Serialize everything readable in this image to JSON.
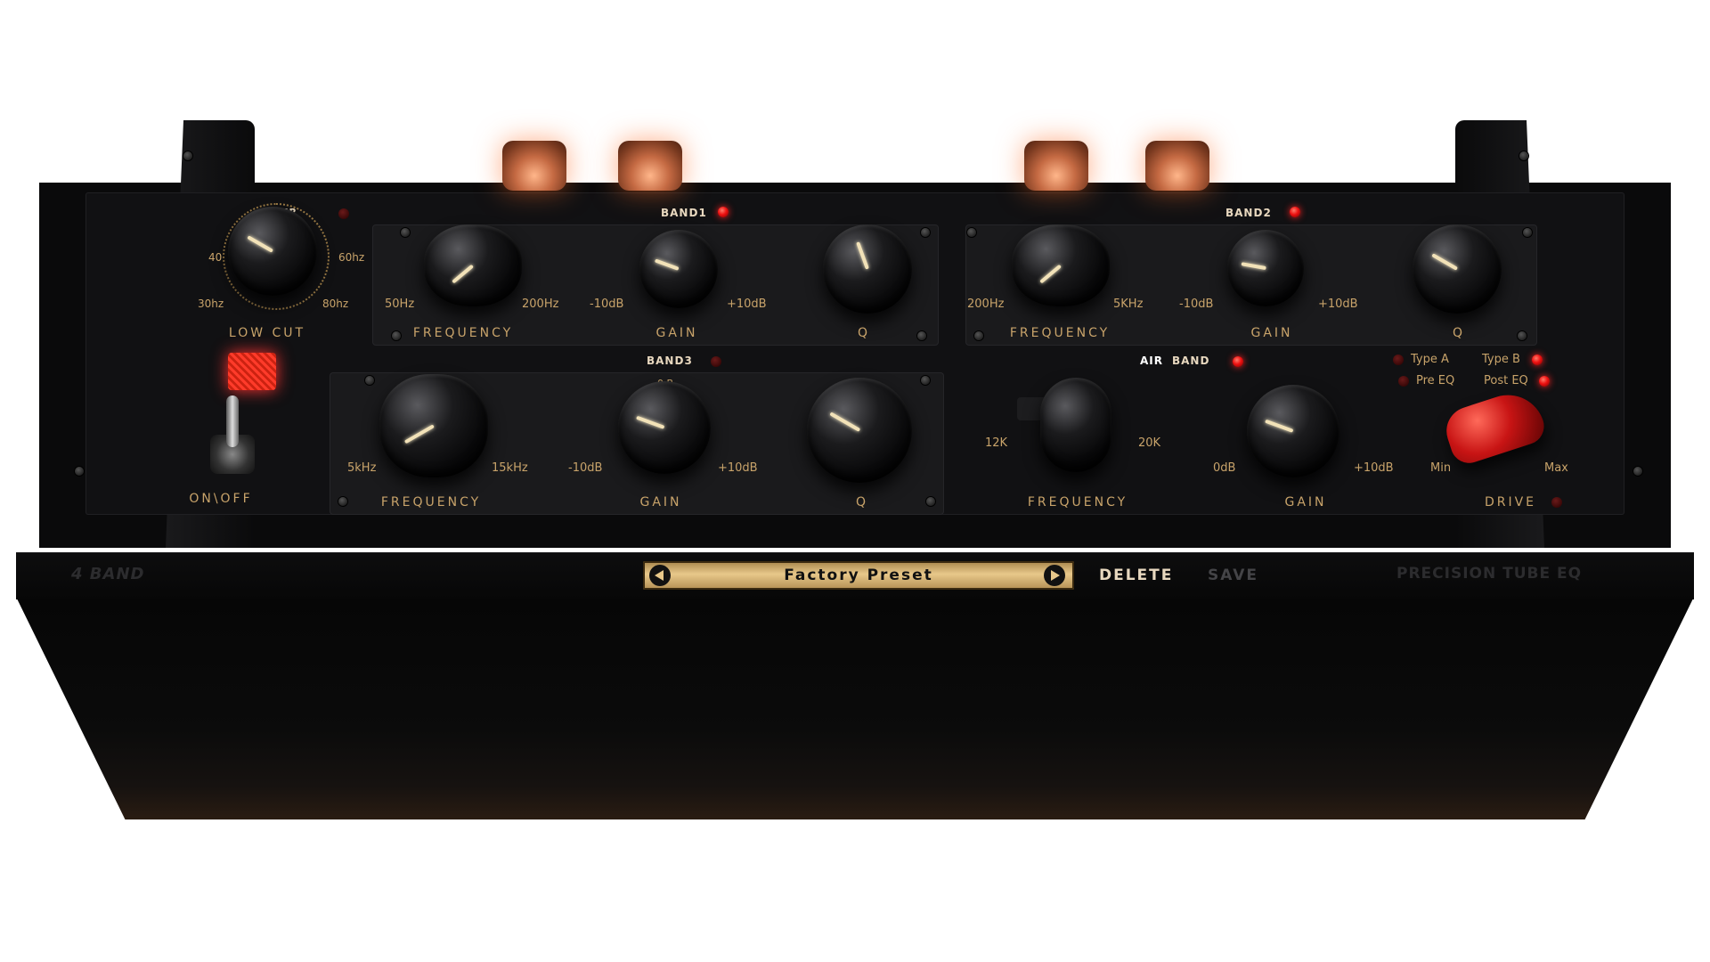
{
  "colors": {
    "accent_gold": "#c8a36a",
    "led_red": "#e11111",
    "chassis": "#0b0b0c",
    "drive_knob": "#c81414"
  },
  "header": {
    "left_brand": "4 BAND",
    "right_brand": "PRECISION TUBE EQ"
  },
  "low_cut": {
    "section_label": "LOW CUT",
    "title_partial": "ER",
    "ticks": {
      "t40": "40",
      "t60": "60hz",
      "t30": "30hz",
      "t80": "80hz"
    }
  },
  "power": {
    "label": "ON\\OFF"
  },
  "band1": {
    "title": "BAND1",
    "frequency": {
      "label": "FREQUENCY",
      "min": "50Hz",
      "max": "200Hz"
    },
    "gain": {
      "label": "GAIN",
      "min": "-10dB",
      "max": "+10dB"
    },
    "q": {
      "label": "Q"
    }
  },
  "band2": {
    "title": "BAND2",
    "frequency": {
      "label": "FREQUENCY",
      "min": "200Hz",
      "max": "5KHz"
    },
    "gain": {
      "label": "GAIN",
      "min": "-10dB",
      "max": "+10dB"
    },
    "q": {
      "label": "Q"
    }
  },
  "band3": {
    "title": "BAND3",
    "frequency": {
      "label": "FREQUENCY",
      "min": "5kHz",
      "max": "15kHz"
    },
    "gain": {
      "label": "GAIN",
      "min": "-10dB",
      "max": "+10dB",
      "partial": "0 B"
    },
    "q": {
      "label": "Q"
    }
  },
  "air_band": {
    "title_air": "AIR",
    "title_band": "BAND",
    "frequency": {
      "label": "FREQUENCY",
      "min": "12K",
      "max": "20K"
    },
    "gain": {
      "label": "GAIN",
      "min": "0dB",
      "max": "+10dB"
    }
  },
  "mode": {
    "type_a": "Type A",
    "type_b": "Type B",
    "pre_eq": "Pre EQ",
    "post_eq": "Post EQ"
  },
  "drive": {
    "label": "DRIVE",
    "min": "Min",
    "max": "Max"
  },
  "preset": {
    "name": "Factory Preset",
    "prev_icon": "triangle-left",
    "next_icon": "triangle-right"
  },
  "actions": {
    "delete": "DELETE",
    "save": "SAVE"
  }
}
